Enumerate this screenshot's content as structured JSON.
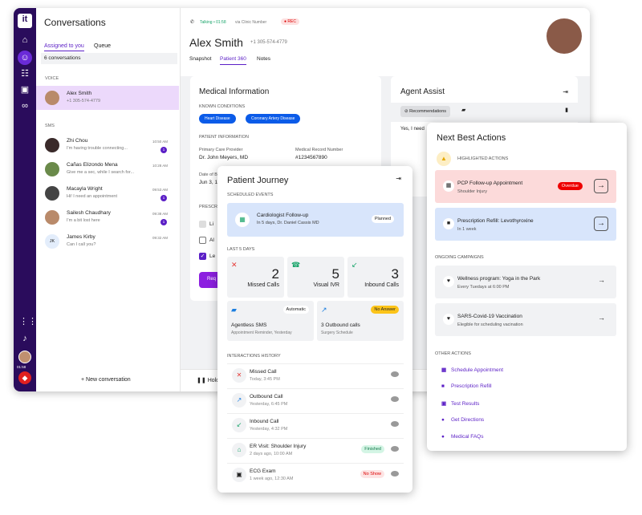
{
  "rail": {
    "logo": "it",
    "icons": [
      "home-icon",
      "agent-icon",
      "tasks-icon",
      "contacts-icon",
      "voicemail-icon",
      "grid-icon",
      "bell-icon"
    ],
    "timer": "01:58"
  },
  "conversations": {
    "title": "Conversations",
    "tabs": [
      "Assigned to you",
      "Queue"
    ],
    "count": "6 conversations",
    "voice_label": "VOICE",
    "sms_label": "SMS",
    "voice": [
      {
        "name": "Alex Smith",
        "preview": "+1 305-574-4779"
      }
    ],
    "sms": [
      {
        "name": "Zhi Chou",
        "preview": "I'm having trouble connecting...",
        "time": "10:50 AM",
        "badge": "1"
      },
      {
        "name": "Cañas Elizondo Mena",
        "preview": "Give me a sec, while I search for...",
        "time": "10:28 AM"
      },
      {
        "name": "Macayla Wright",
        "preview": "Hi! I need an appointment",
        "time": "09:53 AM",
        "badge": "1"
      },
      {
        "name": "Sailesh Chaudhary",
        "preview": "I'm a bit lost here",
        "time": "09:38 AM",
        "badge": "1"
      },
      {
        "name": "James Kirby",
        "initials": "JK",
        "preview": "Can I call you?",
        "time": "09:32 AM"
      }
    ],
    "new_conversation": "New conversation"
  },
  "header": {
    "call_status": "Talking • 01:58",
    "via": "via Clinic Number",
    "rec": "REC",
    "name": "Alex Smith",
    "phone": "+1 305-574-4779",
    "tabs": [
      "Snapshot",
      "Patient 360",
      "Notes"
    ],
    "active_tab": "Patient 360"
  },
  "medical": {
    "title": "Medical Information",
    "known_conditions": "KNOWN CONDITIONS",
    "conditions": [
      "Heart Disease",
      "Coronary Artery Disease"
    ],
    "patient_info": "PATIENT INFORMATION",
    "pcp_label": "Primary Care Provider",
    "pcp": "Dr. John Meyers, MD",
    "mrn_label": "Medical Record Number",
    "mrn": "#1234567890",
    "dob_label": "Date of B",
    "dob": "Jun 3, 1",
    "presc": "PRESCR",
    "items": [
      "Li",
      "Al",
      "Le"
    ],
    "button": "Req"
  },
  "agent_assist": {
    "title": "Agent Assist",
    "recommendations": "Recommendations",
    "message": "Yes, I need"
  },
  "bottom": {
    "hold": "Hold"
  },
  "journey": {
    "title": "Patient Journey",
    "scheduled": "SCHEDULED EVENTS",
    "event": {
      "title": "Cardiologist Follow-up",
      "sub": "In 5 days, Dr. Daniel Cassis MD",
      "status": "Planned"
    },
    "last5": "LAST 5 DAYS",
    "stats": [
      {
        "value": "2",
        "label": "Missed Calls",
        "color": "#e53935"
      },
      {
        "value": "5",
        "label": "Visual IVR",
        "color": "#1aa56b"
      },
      {
        "value": "3",
        "label": "Inbound Calls",
        "color": "#1aa56b"
      }
    ],
    "tiles": [
      {
        "title": "Agentless SMS",
        "sub": "Appointment Reminder, Yesterday",
        "tag": "Automatic"
      },
      {
        "title": "3 Outbound calls",
        "sub": "Surgery Schedule",
        "tag": "No Answer"
      }
    ],
    "history_label": "INTERACTIONS HISTORY",
    "history": [
      {
        "title": "Missed Call",
        "sub": "Today, 3:45 PM"
      },
      {
        "title": "Outbound Call",
        "sub": "Yesterday, 6:45 PM"
      },
      {
        "title": "Inbound Call",
        "sub": "Yesterday, 4:32 PM"
      },
      {
        "title": "ER Visit: Shoulder Injury",
        "sub": "2 days ago, 10:00 AM",
        "tag": "Finished"
      },
      {
        "title": "ECG Exam",
        "sub": "1 week ago, 12:30 AM",
        "tag": "No Show"
      }
    ]
  },
  "nba": {
    "title": "Next Best Actions",
    "highlighted": "HIGHLIGHTED ACTIONS",
    "actions": [
      {
        "title": "PCP Follow-up Appointment",
        "sub": "Shoulder Injury",
        "tag": "Overdue"
      },
      {
        "title": "Prescription Refill: Levothyroxine",
        "sub": "In 1 week"
      }
    ],
    "campaigns_label": "ONGOING CAMPAIGNS",
    "campaigns": [
      {
        "title": "Wellness program: Yoga in the Park",
        "sub": "Every Tuedays at 6:00 PM"
      },
      {
        "title": "SARS-Covid-19 Vaccination",
        "sub": "Elegible for scheduling vacination"
      }
    ],
    "other_label": "OTHER ACTIONS",
    "other": [
      "Schedule Appointment",
      "Prescription Refill",
      "Test Results",
      "Get Directions",
      "Medical FAQs"
    ]
  },
  "colors": {
    "rail": "#2a0c5c",
    "accent": "#5b1fc6",
    "selected": "#ecd9fb",
    "pill": "#0b5be8",
    "overdue_bg": "#fcdada",
    "refill_bg": "#d8e5fb"
  }
}
